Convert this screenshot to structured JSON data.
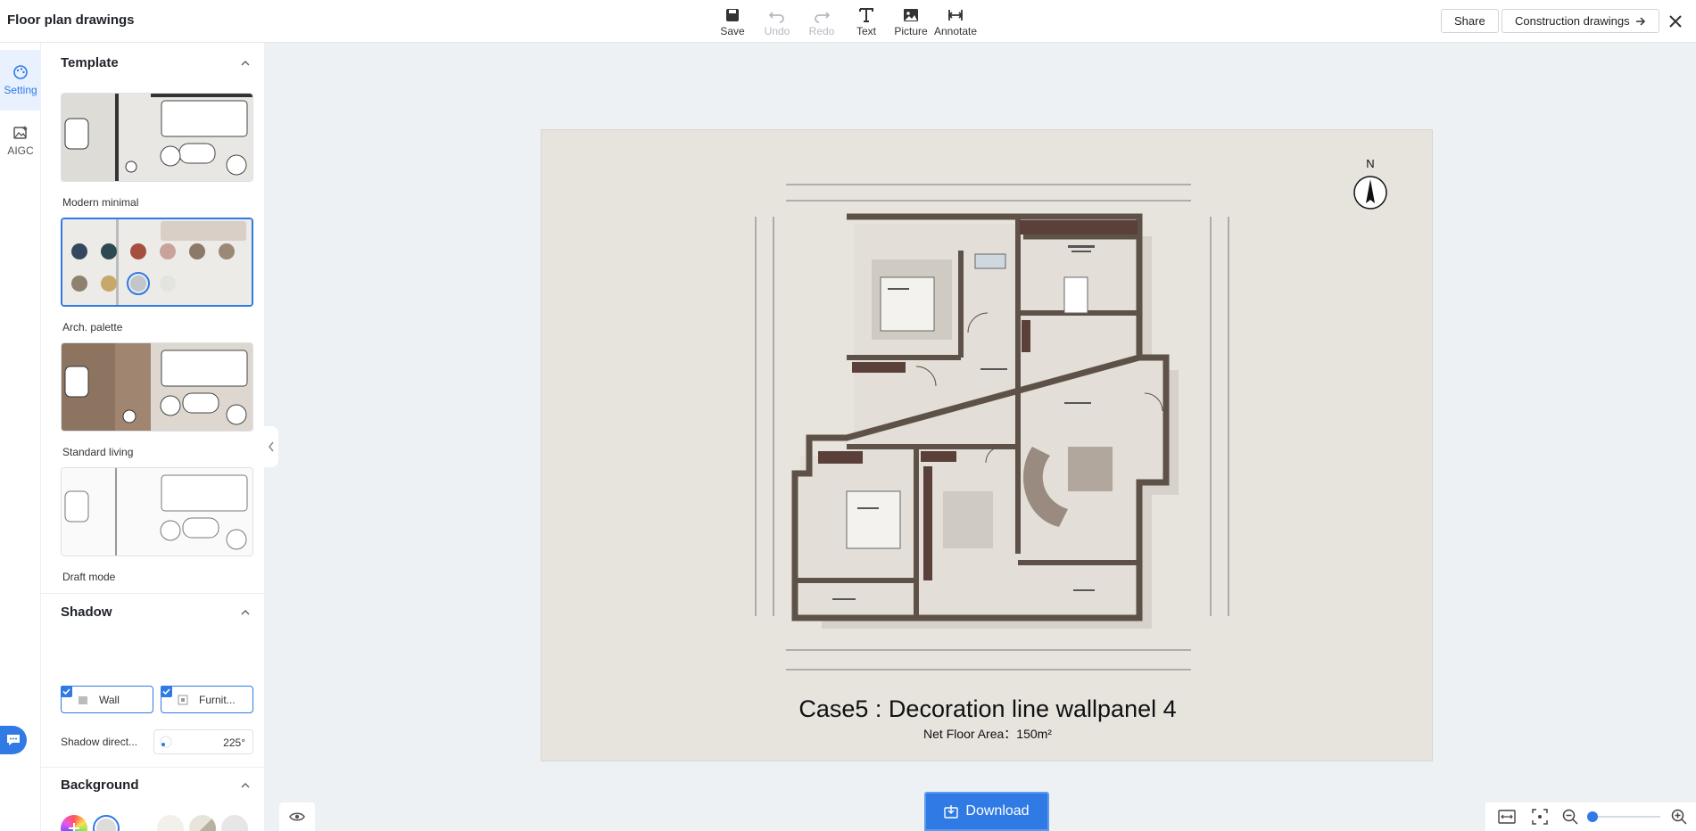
{
  "app": {
    "title": "Floor plan drawings"
  },
  "toolbar": {
    "save": "Save",
    "undo": "Undo",
    "redo": "Redo",
    "text": "Text",
    "picture": "Picture",
    "annotate": "Annotate"
  },
  "header": {
    "share": "Share",
    "construction": "Construction drawings"
  },
  "rail": {
    "setting": "Setting",
    "aigc": "AIGC"
  },
  "panel": {
    "template_title": "Template",
    "templates": [
      {
        "label": "Modern minimal"
      },
      {
        "label": "Arch. palette"
      },
      {
        "label": "Standard living"
      },
      {
        "label": "Draft mode"
      }
    ],
    "palette_colors": [
      "#35475d",
      "#2d4a52",
      "#a5503e",
      "#c9a39a",
      "#8c7a68",
      "#9a8976",
      "#8e8170",
      "#c8a76a",
      "#c2c5c9",
      "#e3e3e0"
    ],
    "shadow_title": "Shadow",
    "shadow_wall": "Wall",
    "shadow_furniture": "Furnit...",
    "shadow_direction_label": "Shadow direct...",
    "shadow_direction_value": "225°",
    "background_title": "Background",
    "background_colors": [
      "#dcdcdc",
      "#f1f0eb",
      "#cfc9bd",
      "#e6e6e6"
    ]
  },
  "canvas": {
    "compass": "N",
    "title": "Case5 : Decoration line wallpanel 4",
    "subtitle": "Net Floor Area：150m²"
  },
  "bottom": {
    "download": "Download"
  }
}
